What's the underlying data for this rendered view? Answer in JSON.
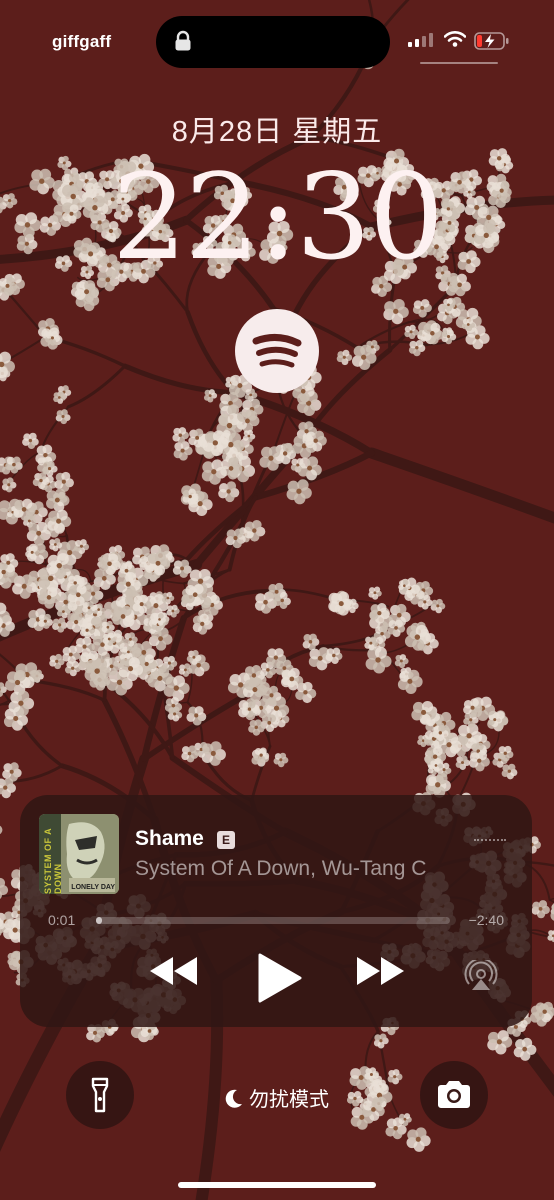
{
  "status": {
    "carrier": "giffgaff",
    "battery_color": "#ff3b30"
  },
  "lock": {
    "date": "8月28日 星期五",
    "time": "22:30"
  },
  "now_playing": {
    "app_icon": "spotify-icon",
    "album_art_band": "SYSTEM OF A DOWN",
    "album_art_caption": "LONELY DAY",
    "title": "Shame",
    "explicit_badge": "E",
    "artist": "System Of A Down, Wu-Tang C",
    "elapsed": "0:01",
    "remaining": "−2:40",
    "progress": 0.006
  },
  "bottom": {
    "focus_label": "勿扰模式",
    "flashlight_icon": "flashlight-icon",
    "camera_icon": "camera-icon"
  },
  "colors": {
    "wallpaper": "#5e1f1c",
    "player_bg": "#301614"
  }
}
